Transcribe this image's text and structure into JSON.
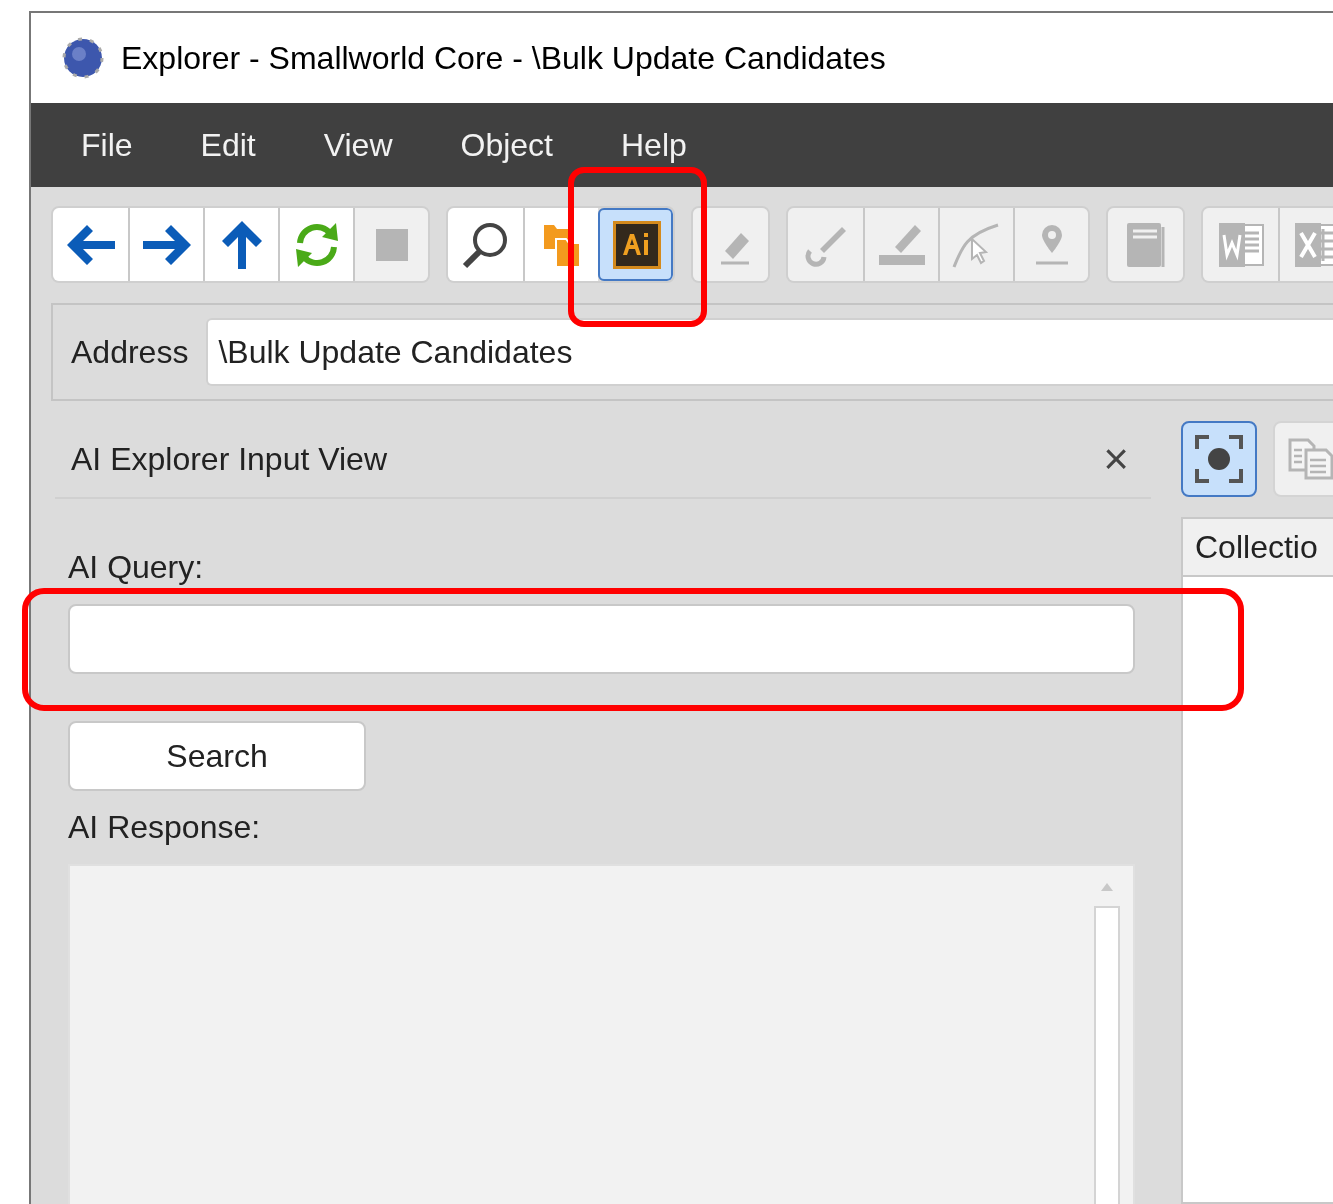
{
  "window": {
    "title": "Explorer - Smallworld Core - \\Bulk Update Candidates"
  },
  "menu": [
    "File",
    "Edit",
    "View",
    "Object",
    "Help"
  ],
  "toolbar": [
    [
      {
        "kind": "back",
        "disabled": false,
        "selected": false
      },
      {
        "kind": "forward",
        "disabled": false,
        "selected": false
      },
      {
        "kind": "up",
        "disabled": false,
        "selected": false
      },
      {
        "kind": "refresh",
        "disabled": false,
        "selected": false
      },
      {
        "kind": "stop",
        "disabled": true,
        "selected": false
      }
    ],
    [
      {
        "kind": "search",
        "disabled": false,
        "selected": false
      },
      {
        "kind": "folders",
        "disabled": false,
        "selected": false
      },
      {
        "kind": "ai",
        "disabled": false,
        "selected": true
      }
    ],
    [
      {
        "kind": "eraser",
        "disabled": true,
        "selected": false
      }
    ],
    [
      {
        "kind": "wrench",
        "disabled": true,
        "selected": false
      },
      {
        "kind": "ruler",
        "disabled": true,
        "selected": false
      },
      {
        "kind": "curve",
        "disabled": true,
        "selected": false
      },
      {
        "kind": "pin",
        "disabled": true,
        "selected": false
      }
    ],
    [
      {
        "kind": "document",
        "disabled": true,
        "selected": false
      }
    ],
    [
      {
        "kind": "word",
        "disabled": true,
        "selected": false
      },
      {
        "kind": "excel",
        "disabled": true,
        "selected": false
      }
    ]
  ],
  "address": {
    "label": "Address",
    "value": "\\Bulk Update Candidates"
  },
  "input_view": {
    "title": "AI Explorer Input View",
    "close": "×",
    "query_label": "AI Query:",
    "search_button": "Search",
    "response_label": "AI Response:"
  },
  "side_tools": [
    {
      "kind": "focus",
      "selected": true
    },
    {
      "kind": "copy",
      "selected": false
    }
  ],
  "side_panel": {
    "header": "Collectio"
  }
}
